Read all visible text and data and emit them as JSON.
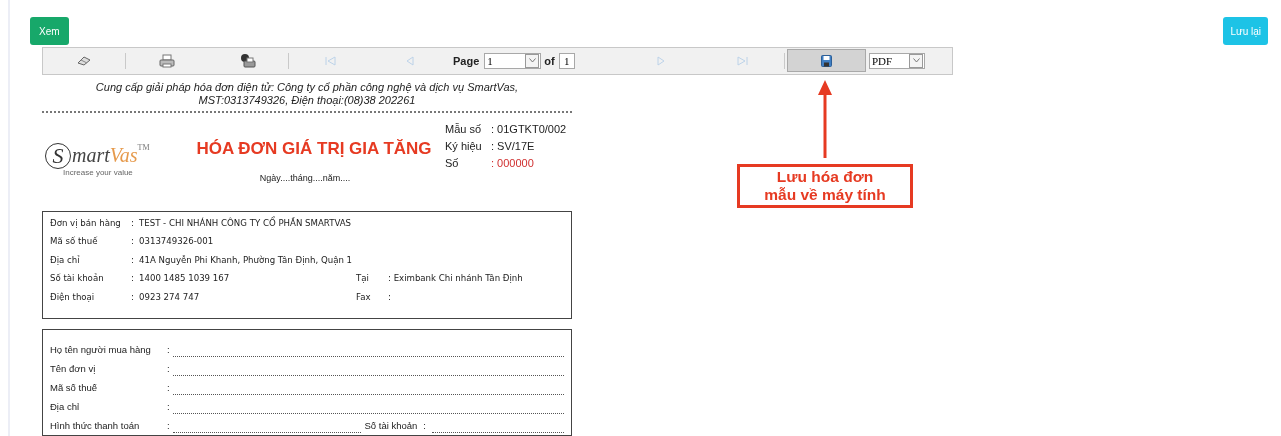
{
  "buttons": {
    "view": "Xem",
    "save": "Lưu lại"
  },
  "toolbar": {
    "left_tools": [
      {
        "kind": "eraser",
        "disabled": false
      },
      {
        "kind": "print",
        "disabled": false
      },
      {
        "kind": "export",
        "disabled": false
      }
    ],
    "back_tools": [
      {
        "kind": "first",
        "disabled": true
      },
      {
        "kind": "prev",
        "disabled": true
      }
    ],
    "page_label": "Page",
    "page_value": "1",
    "of_label": "of",
    "page_count": "1",
    "forward_tools": [
      {
        "kind": "next",
        "disabled": true
      },
      {
        "kind": "last",
        "disabled": true
      }
    ],
    "save_tool": {
      "pressed": true
    },
    "format": "PDF"
  },
  "invoice": {
    "provider_lines": [
      "Cung cấp giải pháp hóa đơn điện tử: Công ty cổ phần công nghệ và dịch vụ SmartVas,",
      "MST:0313749326, Điện thoại:(08)38 202261"
    ],
    "logo": {
      "initial": "S",
      "rest": "mart",
      "accent": "Vas",
      "mark": "TM",
      "tagline": "Increase your value"
    },
    "title": "HÓA ĐƠN GIÁ TRỊ GIA TĂNG",
    "date_line": "Ngày....tháng....năm....",
    "meta": [
      {
        "label": "Mẫu số",
        "value": ": 01GTKT0/002",
        "highlighted": false
      },
      {
        "label": "Ký hiệu",
        "value": ": SV/17E",
        "highlighted": false
      },
      {
        "label": "Số",
        "value": ": 000000",
        "highlighted": true
      }
    ],
    "seller": [
      {
        "label": "Đơn vị bán hàng",
        "colon": ":",
        "value": "TEST - CHI NHÁNH CÔNG TY CỔ PHẦN SMARTVAS"
      },
      {
        "label": "Mã số thuế",
        "colon": ":",
        "value": "0313749326-001"
      },
      {
        "label": "Địa chỉ",
        "colon": ":",
        "value": "41A Nguyễn Phi Khanh, Phường Tân Định, Quận 1"
      },
      {
        "label": "Số tài khoản",
        "colon": ":",
        "value": "1400 1485 1039 167",
        "extra_label": "Tại",
        "extra_value": ": Eximbank Chi nhánh Tân Định"
      },
      {
        "label": "Điện thoại",
        "colon": ":",
        "value": "0923 274 747",
        "extra_label": "Fax",
        "extra_value": ":"
      }
    ],
    "buyer": [
      {
        "label": "Họ tên người mua hàng",
        "colon": ":"
      },
      {
        "label": "Tên đơn vị",
        "colon": ":"
      },
      {
        "label": "Mã số thuế",
        "colon": ":"
      },
      {
        "label": "Địa chỉ",
        "colon": ":"
      },
      {
        "label": "Hình thức thanh toán",
        "colon": ":",
        "extra_label": "Số tài khoản",
        "extra_colon": ":"
      }
    ]
  },
  "annotation": {
    "lines": [
      "Lưu hóa đơn",
      "mẫu về máy tính"
    ]
  }
}
